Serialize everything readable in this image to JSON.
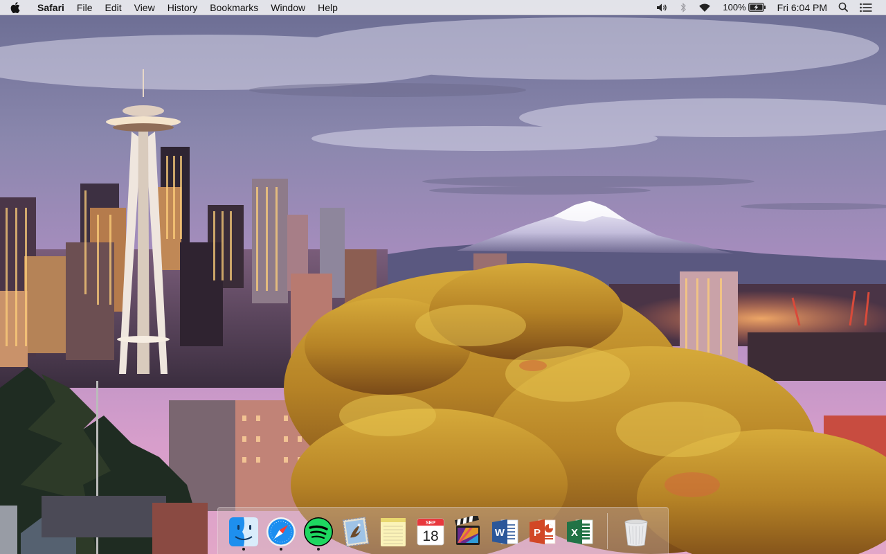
{
  "menubar": {
    "app_name": "Safari",
    "items": [
      "File",
      "Edit",
      "View",
      "History",
      "Bookmarks",
      "Window",
      "Help"
    ],
    "status": {
      "volume_icon": "volume-icon",
      "bluetooth_icon": "bluetooth-icon",
      "wifi_icon": "wifi-icon",
      "battery_percent": "100%",
      "battery_icon": "battery-charging-icon",
      "clock": "Fri 6:04 PM",
      "spotlight_icon": "search-icon",
      "notifications_icon": "list-icon"
    }
  },
  "wallpaper": {
    "scene": "seattle-skyline-wallpaper"
  },
  "dock": {
    "apps": [
      {
        "id": "finder",
        "icon": "finder-icon",
        "running": true
      },
      {
        "id": "safari",
        "icon": "safari-icon",
        "running": true
      },
      {
        "id": "spotify",
        "icon": "spotify-icon",
        "running": true
      },
      {
        "id": "mail",
        "icon": "mail-icon",
        "running": false
      },
      {
        "id": "notes",
        "icon": "notes-icon",
        "running": false
      },
      {
        "id": "calendar",
        "icon": "calendar-icon",
        "running": false,
        "month": "SEP",
        "day": "18"
      },
      {
        "id": "final-cut-pro",
        "icon": "clapper-icon",
        "running": false
      },
      {
        "id": "word",
        "icon": "word-icon",
        "running": false,
        "letter": "W"
      },
      {
        "id": "powerpoint",
        "icon": "powerpoint-icon",
        "running": false,
        "letter": "P"
      },
      {
        "id": "excel",
        "icon": "excel-icon",
        "running": false,
        "letter": "X"
      }
    ],
    "trash": {
      "icon": "trash-icon"
    }
  },
  "colors": {
    "menubar_bg": "#ececf0",
    "sky_top": "#5e5f86",
    "sky_horizon": "#c88fbd",
    "foliage": "#c39a2e",
    "spotify": "#1ed760",
    "word": "#2b579a",
    "powerpoint": "#d24726",
    "excel": "#217346"
  }
}
